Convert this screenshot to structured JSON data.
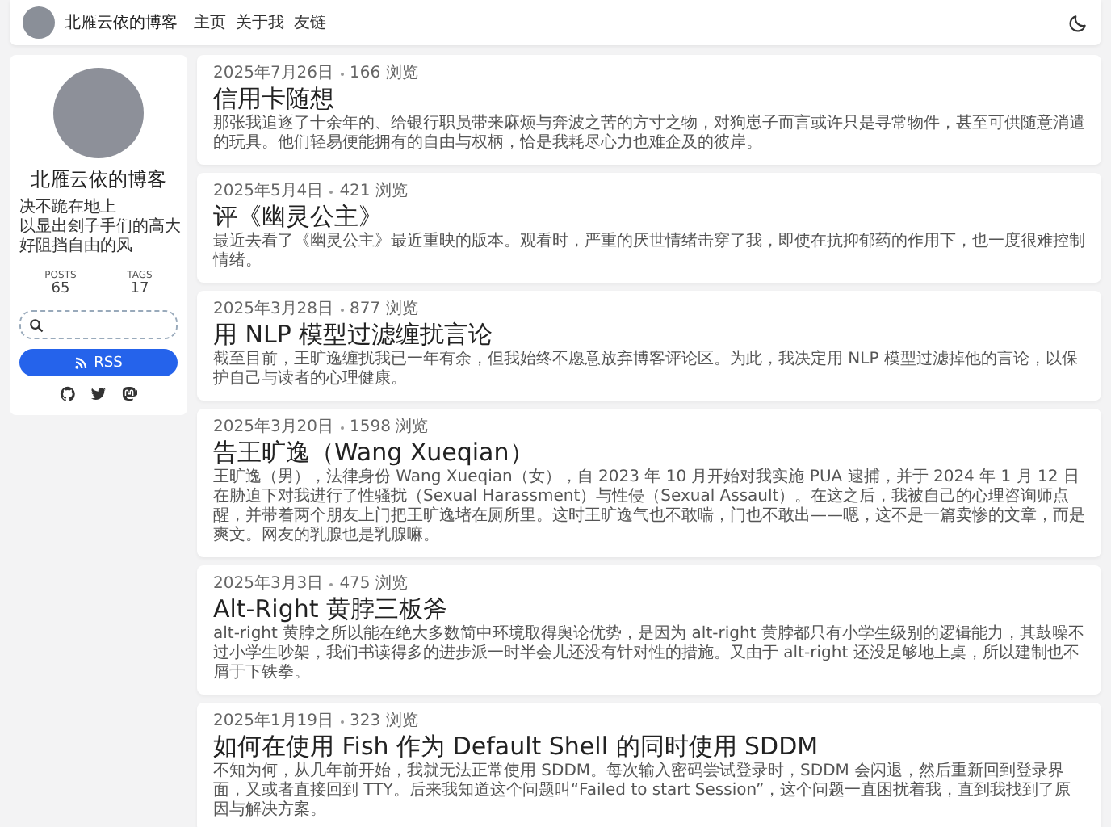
{
  "nav": {
    "site_title": "北雁云依的博客",
    "links": [
      "主页",
      "关于我",
      "友链"
    ]
  },
  "profile": {
    "name": "北雁云依的博客",
    "motto": [
      "决不跪在地上",
      "以显出刽子手们的高大",
      "好阻挡自由的风"
    ],
    "stats": [
      {
        "label": "POSTS",
        "value": "65"
      },
      {
        "label": "TAGS",
        "value": "17"
      }
    ],
    "rss_button": "RSS",
    "socials": [
      {
        "kind": "github"
      },
      {
        "kind": "twitter"
      },
      {
        "kind": "mastodon"
      }
    ]
  },
  "posts": [
    {
      "date": "2025年7月26日",
      "views": "166 浏览",
      "title": "信用卡随想",
      "summary": "那张我追逐了十余年的、给银行职员带来麻烦与奔波之苦的方寸之物，对狗崽子而言或许只是寻常物件，甚至可供随意消遣的玩具。他们轻易便能拥有的自由与权柄，恰是我耗尽心力也难企及的彼岸。"
    },
    {
      "date": "2025年5月4日",
      "views": "421 浏览",
      "title": "评《幽灵公主》",
      "summary": "最近去看了《幽灵公主》最近重映的版本。观看时，严重的厌世情绪击穿了我，即使在抗抑郁药的作用下，也一度很难控制情绪。"
    },
    {
      "date": "2025年3月28日",
      "views": "877 浏览",
      "title": "用 NLP 模型过滤缠扰言论",
      "summary": "截至目前，王旷逸缠扰我已一年有余，但我始终不愿意放弃博客评论区。为此，我决定用 NLP 模型过滤掉他的言论，以保护自己与读者的心理健康。"
    },
    {
      "date": "2025年3月20日",
      "views": "1598 浏览",
      "title": "告王旷逸（Wang Xueqian）",
      "summary": "王旷逸（男），法律身份 Wang Xueqian（女），自 2023 年 10 月开始对我实施 PUA 逮捕，并于 2024 年 1 月 12 日在胁迫下对我进行了性骚扰（Sexual Harassment）与性侵（Sexual Assault）。在这之后，我被自己的心理咨询师点醒，并带着两个朋友上门把王旷逸堵在厕所里。这时王旷逸气也不敢喘，门也不敢出——嗯，这不是一篇卖惨的文章，而是爽文。网友的乳腺也是乳腺嘛。"
    },
    {
      "date": "2025年3月3日",
      "views": "475 浏览",
      "title": "Alt-Right 黄脖三板斧",
      "summary": "alt-right 黄脖之所以能在绝大多数简中环境取得舆论优势，是因为 alt-right 黄脖都只有小学生级别的逻辑能力，其鼓噪不过小学生吵架，我们书读得多的进步派一时半会儿还没有针对性的措施。又由于 alt-right 还没足够地上桌，所以建制也不屑于下铁拳。"
    },
    {
      "date": "2025年1月19日",
      "views": "323 浏览",
      "title": "如何在使用 Fish 作为 Default Shell 的同时使用 SDDM",
      "summary": "不知为何，从几年前开始，我就无法正常使用 SDDM。每次输入密码尝试登录时，SDDM 会闪退，然后重新回到登录界面，又或者直接回到 TTY。后来我知道这个问题叫“Failed to start Session”，这个问题一直困扰着我，直到我找到了原因与解决方案。"
    }
  ]
}
